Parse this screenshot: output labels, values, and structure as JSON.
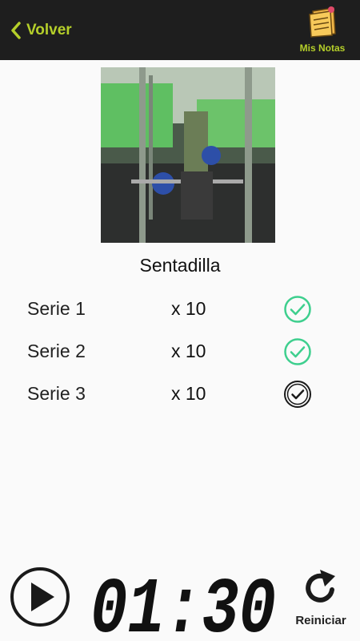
{
  "header": {
    "back_label": "Volver",
    "notes_label": "Mis Notas"
  },
  "exercise": {
    "name": "Sentadilla"
  },
  "sets": [
    {
      "label": "Serie 1",
      "reps": "x 10",
      "status": "completed"
    },
    {
      "label": "Serie 2",
      "reps": "x 10",
      "status": "completed"
    },
    {
      "label": "Serie 3",
      "reps": "x 10",
      "status": "pending"
    }
  ],
  "timer": {
    "display": "01:30",
    "reset_label": "Reiniciar"
  },
  "colors": {
    "accent": "#b5cf2a",
    "check_done": "#3ecf8e",
    "check_pending": "#1a1a1a",
    "header_bg": "#1e1e1e"
  }
}
